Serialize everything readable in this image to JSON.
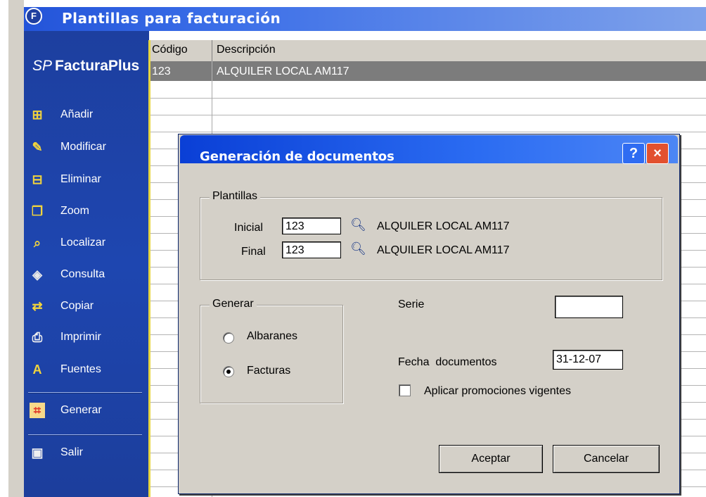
{
  "window": {
    "title": "Plantillas para facturación",
    "icon": "app-f-icon"
  },
  "brand": {
    "prefix": "SP",
    "name": "FacturaPlus"
  },
  "sidebar": {
    "items": [
      {
        "label": "Añadir",
        "icon": "add-icon"
      },
      {
        "label": "Modificar",
        "icon": "edit-icon"
      },
      {
        "label": "Eliminar",
        "icon": "delete-icon"
      },
      {
        "label": "Zoom",
        "icon": "zoom-icon"
      },
      {
        "label": "Localizar",
        "icon": "locate-icon"
      },
      {
        "label": "Consulta",
        "icon": "query-icon"
      },
      {
        "label": "Copiar",
        "icon": "copy-icon"
      },
      {
        "label": "Imprimir",
        "icon": "print-icon"
      },
      {
        "label": "Fuentes",
        "icon": "fonts-icon"
      },
      {
        "label": "Generar",
        "icon": "generate-icon"
      },
      {
        "label": "Salir",
        "icon": "exit-icon"
      }
    ]
  },
  "grid": {
    "columns": [
      "Código",
      "Descripción"
    ],
    "rows": [
      {
        "codigo": "123",
        "descripcion": "ALQUILER LOCAL AM117"
      }
    ]
  },
  "dialog": {
    "title": "Generación de documentos",
    "help_label": "?",
    "close_label": "×",
    "plantillas": {
      "legend": "Plantillas",
      "inicial_label": "Inicial",
      "inicial_value": "123",
      "inicial_desc": "ALQUILER LOCAL AM117",
      "final_label": "Final",
      "final_value": "123",
      "final_desc": "ALQUILER LOCAL AM117"
    },
    "generar": {
      "legend": "Generar",
      "options": [
        "Albaranes",
        "Facturas"
      ],
      "selected": "Facturas"
    },
    "serie_label": "Serie",
    "serie_value": "",
    "fecha_label": "Fecha  documentos",
    "fecha_value": "31-12-07",
    "promo_label": "Aplicar promociones vigentes",
    "promo_checked": false,
    "accept_label": "Aceptar",
    "cancel_label": "Cancelar"
  },
  "colors": {
    "titlebar": "#2354d9",
    "sidebar": "#1e46b0",
    "dialog_bg": "#d4d0c8",
    "close": "#e2512f"
  }
}
